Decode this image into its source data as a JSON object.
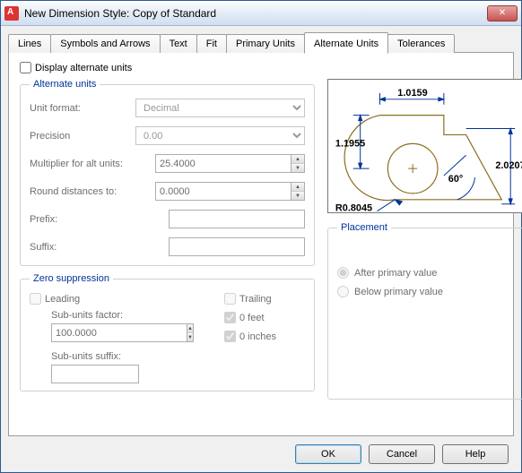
{
  "window": {
    "title": "New Dimension Style: Copy of Standard"
  },
  "tabs": [
    "Lines",
    "Symbols and Arrows",
    "Text",
    "Fit",
    "Primary Units",
    "Alternate Units",
    "Tolerances"
  ],
  "displayAlt": "Display alternate units",
  "altUnits": {
    "legend": "Alternate units",
    "unitFormatLabel": "Unit format:",
    "unitFormatValue": "Decimal",
    "precisionLabel": "Precision",
    "precisionValue": "0.00",
    "multiplierLabel": "Multiplier for alt units:",
    "multiplierValue": "25.4000",
    "roundLabel": "Round distances  to:",
    "roundValue": "0.0000",
    "prefixLabel": "Prefix:",
    "prefixValue": "",
    "suffixLabel": "Suffix:",
    "suffixValue": ""
  },
  "zero": {
    "legend": "Zero suppression",
    "leading": "Leading",
    "trailing": "Trailing",
    "feet": "0 feet",
    "inches": "0 inches",
    "subFactorLabel": "Sub-units factor:",
    "subFactorValue": "100.0000",
    "subSuffixLabel": "Sub-units suffix:",
    "subSuffixValue": ""
  },
  "placement": {
    "legend": "Placement",
    "after": "After primary value",
    "below": "Below primary value"
  },
  "preview": {
    "d1": "1.0159",
    "d2": "1.1955",
    "d3": "2.0207",
    "d4": "R0.8045",
    "angle": "60°"
  },
  "buttons": {
    "ok": "OK",
    "cancel": "Cancel",
    "help": "Help"
  }
}
